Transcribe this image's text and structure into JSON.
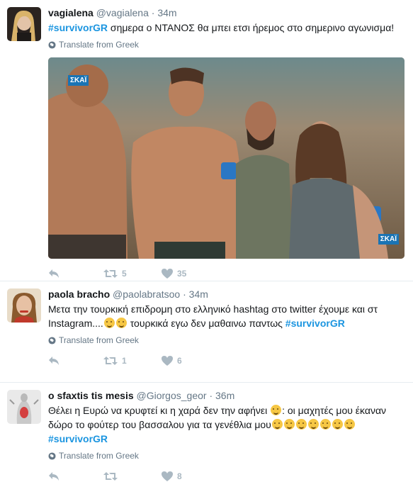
{
  "tweets": [
    {
      "fullname": "vagialena",
      "username": "@vagialena",
      "time": "34m",
      "hashtag_prefix": "#survivorGR",
      "text": " σημερα ο ΝΤΑΝΟΣ θα μπει ετσι ήρεμος στο σημερινο αγωνισμα!",
      "translate": "Translate from Greek",
      "media_logo": "ΣΚΑΪ",
      "retweets": "5",
      "likes": "35"
    },
    {
      "fullname": "paola bracho",
      "username": "@paolabratsoo",
      "time": "34m",
      "text_line1": "Μετα την τουρκική επιδρομη στο ελληνικό  hashtag στο twitter έχουμε και στ",
      "text_line2": "Instagram....",
      "text_line2b": " τουρκικά εγω δεν μαθαινω παντως ",
      "hashtag_suffix": "#survivorGR",
      "translate": "Translate from Greek",
      "retweets": "1",
      "likes": "6"
    },
    {
      "fullname": "o sfaxtis tis mesis",
      "username": "@Giorgos_geor",
      "time": "36m",
      "text_line1": "Θέλει η Ευρώ να κρυφτεί κι η χαρά δεν την αφήνει ",
      "text_line1b": ": οι μαχητές μου έκαναν",
      "text_line2": "δώρο το φούτερ  του βασσαλου για τα γενέθλια μου",
      "hashtag": "#survivorGR",
      "translate": "Translate from Greek",
      "likes": "8"
    }
  ],
  "icons": {
    "reply": "reply-icon",
    "retweet": "retweet-icon",
    "like": "heart-icon",
    "globe": "globe-icon"
  },
  "colors": {
    "hashtag": "#1b95e0",
    "muted": "#657786",
    "action": "#aab8c2",
    "divider": "#e6ecf0"
  }
}
